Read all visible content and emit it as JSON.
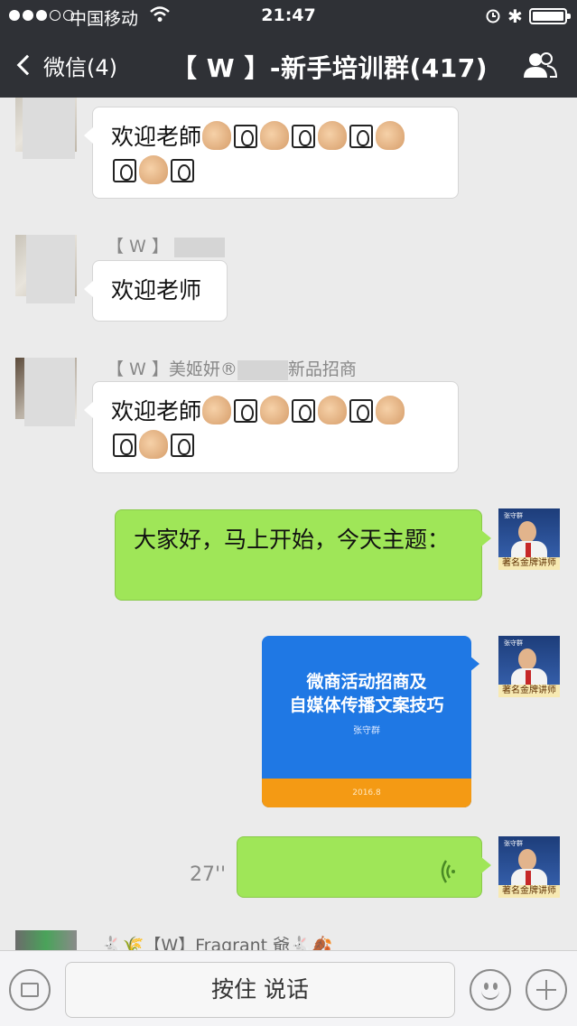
{
  "status_bar": {
    "carrier": "中国移动",
    "time": "21:47"
  },
  "nav": {
    "back_label": "微信(4)",
    "title": "【 W 】-新手培训群(417)"
  },
  "messages": [
    {
      "sender": "",
      "text": "欢迎老師"
    },
    {
      "sender": "【 W 】",
      "text": "欢迎老师"
    },
    {
      "sender": "【 W 】美姬妍®",
      "sender_tail": "新品招商",
      "text": "欢迎老師"
    },
    {
      "text": "大家好，马上开始，今天主题："
    },
    {
      "image": {
        "line1": "微商活动招商及",
        "line2": "自媒体传播文案技巧",
        "author": "张守群",
        "footer": "2016.8"
      }
    },
    {
      "voice_duration": "27''"
    },
    {
      "sender": "【W】Fragrant 爺"
    }
  ],
  "avatar_tag": "著名金牌讲师",
  "input": {
    "hold_to_talk_label": "按住 说话"
  }
}
